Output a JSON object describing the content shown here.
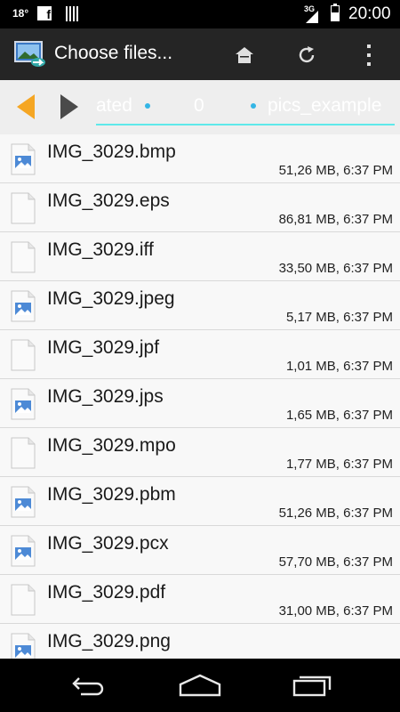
{
  "status_bar": {
    "temperature": "18°",
    "network_type": "3G",
    "time": "20:00"
  },
  "action_bar": {
    "title": "Choose files..."
  },
  "path_bar": {
    "crumbs": [
      "ated",
      "0",
      "pics_example"
    ]
  },
  "colors": {
    "accent": "#33b5e5",
    "path_underline": "#5fe9ea",
    "back_arrow": "#f5a623",
    "forward_arrow": "#4a4a4a"
  },
  "files": [
    {
      "name": "IMG_3029.bmp",
      "meta": "51,26 MB, 6:37 PM",
      "icon": "image-file-icon"
    },
    {
      "name": "IMG_3029.eps",
      "meta": "86,81 MB, 6:37 PM",
      "icon": "blank-file-icon"
    },
    {
      "name": "IMG_3029.iff",
      "meta": "33,50 MB, 6:37 PM",
      "icon": "blank-file-icon"
    },
    {
      "name": "IMG_3029.jpeg",
      "meta": "5,17 MB, 6:37 PM",
      "icon": "image-file-icon"
    },
    {
      "name": "IMG_3029.jpf",
      "meta": "1,01 MB, 6:37 PM",
      "icon": "blank-file-icon"
    },
    {
      "name": "IMG_3029.jps",
      "meta": "1,65 MB, 6:37 PM",
      "icon": "image-file-icon"
    },
    {
      "name": "IMG_3029.mpo",
      "meta": "1,77 MB, 6:37 PM",
      "icon": "blank-file-icon"
    },
    {
      "name": "IMG_3029.pbm",
      "meta": "51,26 MB, 6:37 PM",
      "icon": "image-file-icon"
    },
    {
      "name": "IMG_3029.pcx",
      "meta": "57,70 MB, 6:37 PM",
      "icon": "image-file-icon"
    },
    {
      "name": "IMG_3029.pdf",
      "meta": "31,00 MB, 6:37 PM",
      "icon": "blank-file-icon"
    },
    {
      "name": "IMG_3029.png",
      "meta": "",
      "icon": "image-file-icon"
    }
  ]
}
